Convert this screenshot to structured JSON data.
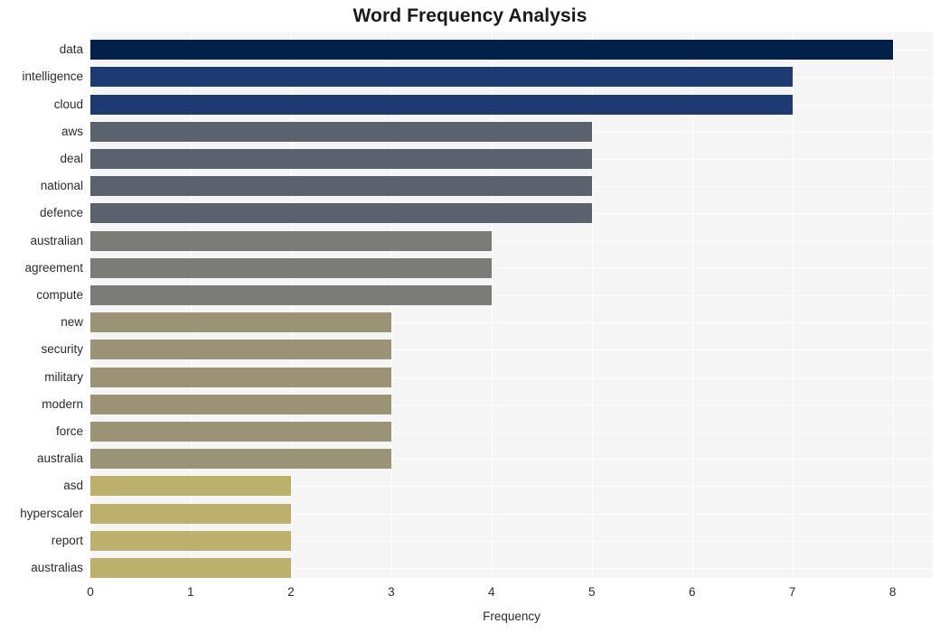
{
  "chart_data": {
    "type": "bar",
    "orientation": "horizontal",
    "title": "Word Frequency Analysis",
    "xlabel": "Frequency",
    "ylabel": "",
    "xlim": [
      0,
      8.4
    ],
    "ylim": [
      0,
      20
    ],
    "xticks": [
      "0",
      "1",
      "2",
      "3",
      "4",
      "5",
      "6",
      "7",
      "8"
    ],
    "xtick_values": [
      0,
      1,
      2,
      3,
      4,
      5,
      6,
      7,
      8
    ],
    "grid": true,
    "legend": "none",
    "categories": [
      "data",
      "intelligence",
      "cloud",
      "aws",
      "deal",
      "national",
      "defence",
      "australian",
      "agreement",
      "compute",
      "new",
      "security",
      "military",
      "modern",
      "force",
      "australia",
      "asd",
      "hyperscaler",
      "report",
      "australias"
    ],
    "values": [
      8,
      7,
      7,
      5,
      5,
      5,
      5,
      4,
      4,
      4,
      3,
      3,
      3,
      3,
      3,
      3,
      2,
      2,
      2,
      2
    ],
    "bar_colors": [
      "#03204b",
      "#1d3a72",
      "#1d3a72",
      "#5c616e",
      "#5c616e",
      "#5c616e",
      "#5c616e",
      "#7b7b78",
      "#7b7b78",
      "#7b7b78",
      "#9b9375",
      "#9b9375",
      "#9b9375",
      "#9b9375",
      "#9b9375",
      "#9b9375",
      "#bdaf6c",
      "#bdaf6c",
      "#bdaf6c",
      "#bdaf6c"
    ],
    "plot_background": "#f5f5f5",
    "gridline_color": "#ffffff",
    "figure_background": "#ffffff"
  }
}
